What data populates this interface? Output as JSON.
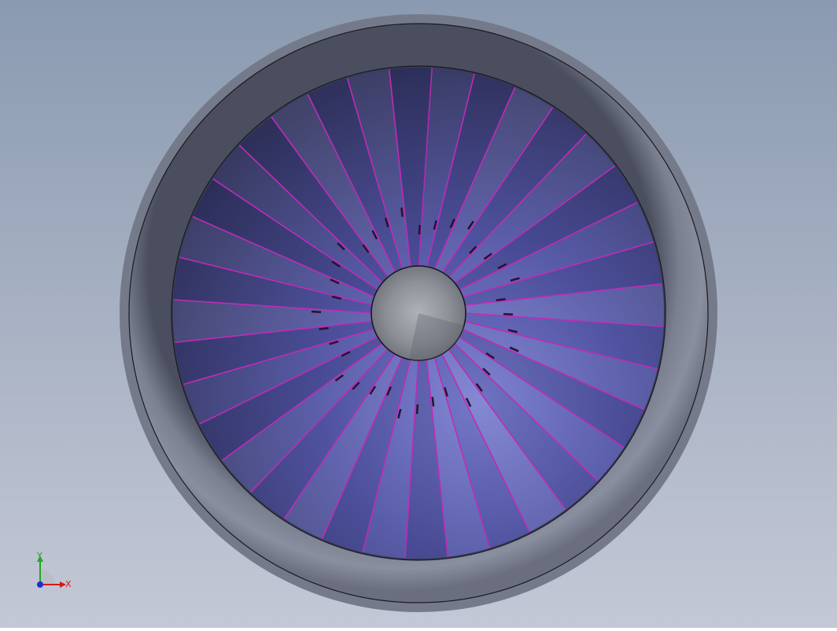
{
  "viewport": {
    "background_top": "#8a9ab0",
    "background_bottom": "#c4c8d6",
    "model": {
      "nacelle_color": "#7d8292",
      "blade_color": "#4f519a",
      "blade_edge_color": "#c12ab9",
      "spinner_color": "#8b8d95",
      "blade_count": 36
    }
  },
  "triad": {
    "x_label": "X",
    "y_label": "Y",
    "x_color": "#d11b1b",
    "y_color": "#1fa81f",
    "z_color": "#1f2ed1"
  }
}
